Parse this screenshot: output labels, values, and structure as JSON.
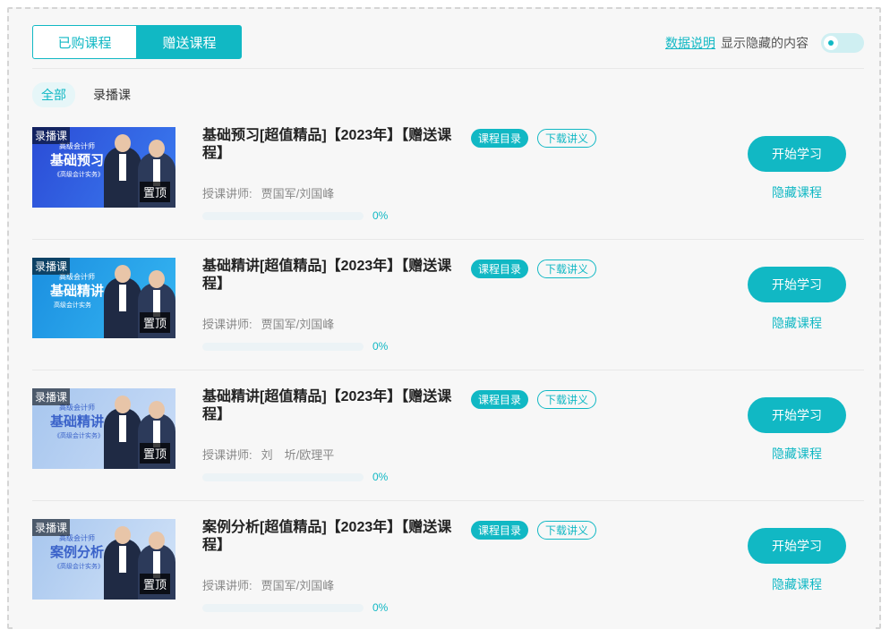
{
  "tabs": [
    "已购课程",
    "赠送课程"
  ],
  "header": {
    "data_link": "数据说明",
    "show_hidden": "显示隐藏的内容"
  },
  "filters": [
    "全部",
    "录播课"
  ],
  "colors": {
    "accent": "#11b8c4"
  },
  "courses": [
    {
      "thumb": {
        "tag": "录播课",
        "sub": "高级会计师",
        "big": "基础预习",
        "book": "《高级会计实务》",
        "top": "置顶"
      },
      "title": "基础预习[超值精品]【2023年】【赠送课程】",
      "catalog": "课程目录",
      "handout": "下载讲义",
      "teacher_label": "授课讲师:",
      "teacher": "贾国军/刘国峰",
      "progress_pct": 0,
      "progress_text": "0%",
      "start": "开始学习",
      "hide": "隐藏课程"
    },
    {
      "thumb": {
        "tag": "录播课",
        "sub": "高级会计师",
        "big": "基础精讲",
        "book": "高级会计实务",
        "top": "置顶"
      },
      "title": "基础精讲[超值精品]【2023年】【赠送课程】",
      "catalog": "课程目录",
      "handout": "下载讲义",
      "teacher_label": "授课讲师:",
      "teacher": "贾国军/刘国峰",
      "progress_pct": 0,
      "progress_text": "0%",
      "start": "开始学习",
      "hide": "隐藏课程"
    },
    {
      "thumb": {
        "tag": "录播课",
        "sub": "高级会计师",
        "big": "基础精讲",
        "book": "《高级会计实务》",
        "top": "置顶"
      },
      "title": "基础精讲[超值精品]【2023年】【赠送课程】",
      "catalog": "课程目录",
      "handout": "下载讲义",
      "teacher_label": "授课讲师:",
      "teacher": "刘　圻/欧理平",
      "progress_pct": 0,
      "progress_text": "0%",
      "start": "开始学习",
      "hide": "隐藏课程"
    },
    {
      "thumb": {
        "tag": "录播课",
        "sub": "高级会计师",
        "big": "案例分析",
        "book": "《高级会计实务》",
        "top": "置顶"
      },
      "title": "案例分析[超值精品]【2023年】【赠送课程】",
      "catalog": "课程目录",
      "handout": "下载讲义",
      "teacher_label": "授课讲师:",
      "teacher": "贾国军/刘国峰",
      "progress_pct": 0,
      "progress_text": "0%",
      "start": "开始学习",
      "hide": "隐藏课程"
    }
  ]
}
